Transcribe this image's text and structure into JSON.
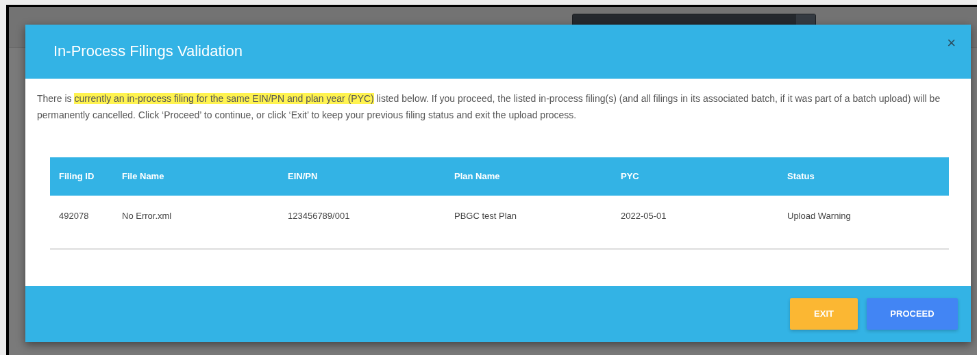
{
  "modal": {
    "title": "In-Process Filings Validation",
    "close": "×",
    "message": {
      "before": "There is ",
      "highlight": "currently an in-process filing for the same EIN/PN and plan year (PYC)",
      "after": " listed below. If you proceed, the listed in-process filing(s) (and all filings in its associated batch, if it was part of a batch upload) will be permanently cancelled. Click ‘Proceed’ to continue, or click ‘Exit’ to keep your previous filing status and exit the upload process."
    },
    "table": {
      "columns": [
        "Filing ID",
        "File Name",
        "EIN/PN",
        "Plan Name",
        "PYC",
        "Status"
      ],
      "rows": [
        [
          "492078",
          "No Error.xml",
          "123456789/001",
          "PBGC test Plan",
          "2022-05-01",
          "Upload Warning"
        ]
      ]
    },
    "buttons": [
      {
        "label": "EXIT",
        "kind": "secondary"
      },
      {
        "label": "PROCEED",
        "kind": "primary"
      }
    ]
  }
}
